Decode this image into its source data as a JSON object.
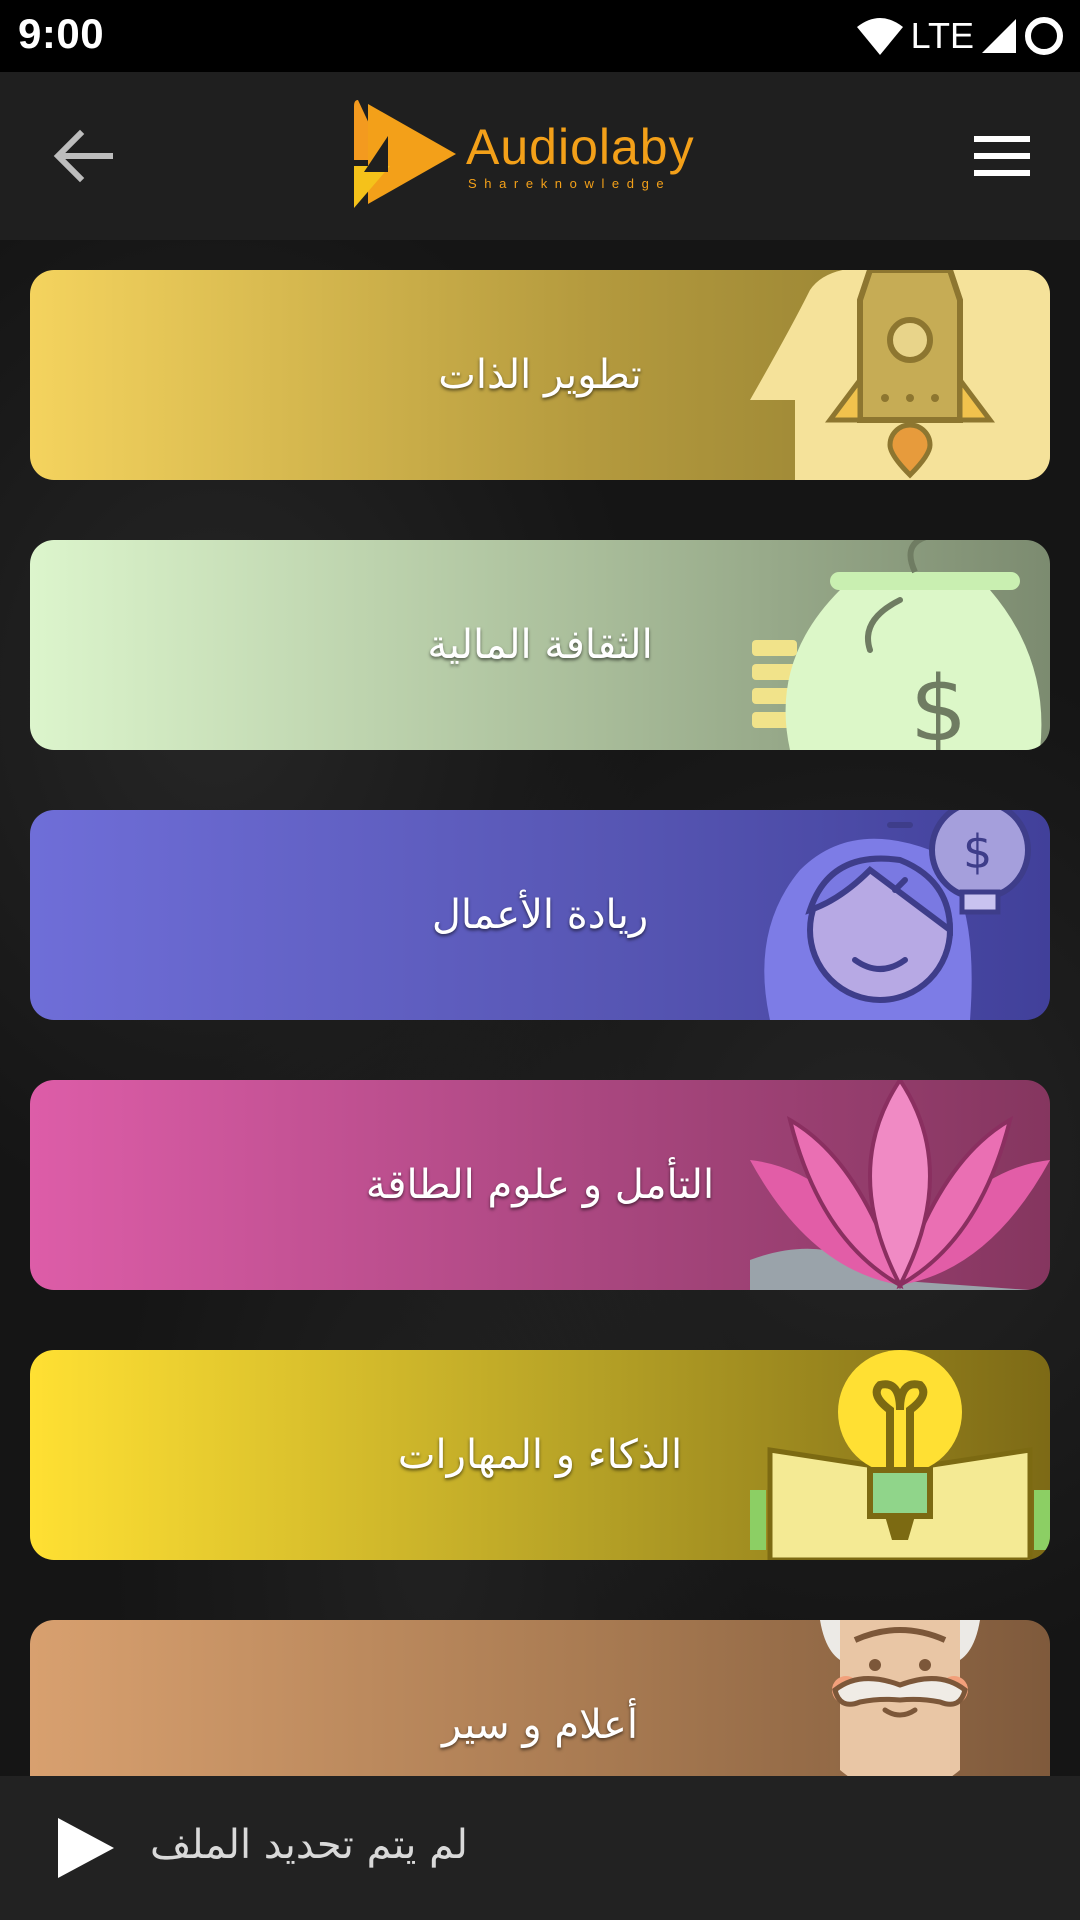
{
  "status_bar": {
    "time": "9:00",
    "network": "LTE"
  },
  "header": {
    "logo_name": "Audiolaby",
    "logo_tagline": "Shareknowledge",
    "colors": {
      "logo": "#f3a019"
    }
  },
  "categories": [
    {
      "label": "تطوير الذات",
      "icon": "rocket-head-icon",
      "gradient": [
        "#f4d35e",
        "#8c7a2f"
      ]
    },
    {
      "label": "الثقافة المالية",
      "icon": "money-bag-icon",
      "gradient": [
        "#dcf5cc",
        "#7c8b70"
      ]
    },
    {
      "label": "ريادة الأعمال",
      "icon": "entrepreneur-idea-icon",
      "gradient": [
        "#6f6ed8",
        "#41409a"
      ]
    },
    {
      "label": "التأمل و علوم الطاقة",
      "icon": "lotus-icon",
      "gradient": [
        "#dd5da8",
        "#85365f"
      ]
    },
    {
      "label": "الذكاء و المهارات",
      "icon": "lightbulb-book-icon",
      "gradient": [
        "#ffe033",
        "#7d6a16"
      ]
    },
    {
      "label": "أعلام و سير",
      "icon": "old-man-face-icon",
      "gradient": [
        "#d8a06f",
        "#7f5a3c"
      ]
    }
  ],
  "player": {
    "status": "لم يتم تحديد الملف"
  }
}
